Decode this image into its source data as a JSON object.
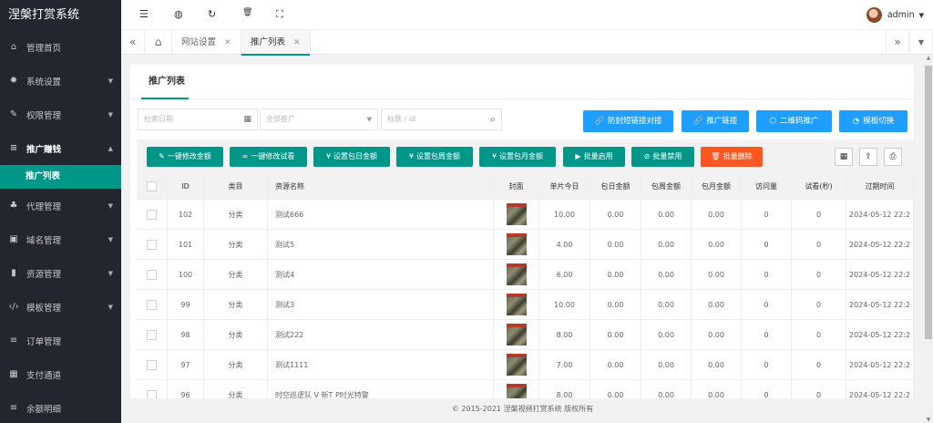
{
  "sidebar": {
    "logo": "涅槃打赏系统",
    "items": [
      {
        "label": "管理首页",
        "icon": "home-icon",
        "glyph": "⌂",
        "arrow": false
      },
      {
        "label": "系统设置",
        "icon": "gear-icon",
        "glyph": "✹",
        "arrow": true
      },
      {
        "label": "权限管理",
        "icon": "key-icon",
        "glyph": "✎",
        "arrow": true
      },
      {
        "label": "推广赚钱",
        "icon": "list-icon",
        "glyph": "≡",
        "arrow": true,
        "open": true
      },
      {
        "label": "代理管理",
        "icon": "users-icon",
        "glyph": "♣",
        "arrow": true
      },
      {
        "label": "域名管理",
        "icon": "domain-icon",
        "glyph": "▣",
        "arrow": true
      },
      {
        "label": "资源管理",
        "icon": "resource-icon",
        "glyph": "▮",
        "arrow": true
      },
      {
        "label": "模板管理",
        "icon": "code-icon",
        "glyph": "‹/›",
        "arrow": true
      },
      {
        "label": "订单管理",
        "icon": "order-icon",
        "glyph": "≡",
        "arrow": false
      },
      {
        "label": "支付通道",
        "icon": "payment-icon",
        "glyph": "▦",
        "arrow": false
      },
      {
        "label": "余额明细",
        "icon": "balance-icon",
        "glyph": "≡",
        "arrow": false
      }
    ],
    "sub_item": "推广列表"
  },
  "header": {
    "user": "admin"
  },
  "tabs": [
    "网站设置",
    "推广列表"
  ],
  "page": {
    "title": "推广列表",
    "search_date_placeholder": "检索日期",
    "search_promo_placeholder": "全部推广",
    "search_keyword_placeholder": "标题 / id",
    "actions": [
      {
        "label": "防封短链接对接",
        "icon": "link-icon",
        "glyph": "🔗"
      },
      {
        "label": "推广链接",
        "icon": "link-icon",
        "glyph": "🔗"
      },
      {
        "label": "二维码推广",
        "icon": "cube-icon",
        "glyph": "⬡"
      },
      {
        "label": "模板切换",
        "icon": "dashboard-icon",
        "glyph": "◔"
      }
    ],
    "toolbar": [
      {
        "label": "一键修改金额",
        "icon": "pencil-icon",
        "glyph": "✎"
      },
      {
        "label": "一键修改试看",
        "icon": "infinity-icon",
        "glyph": "∞"
      },
      {
        "label": "设置包日金额",
        "icon": "yen-icon",
        "glyph": "¥"
      },
      {
        "label": "设置包周金额",
        "icon": "yen-icon",
        "glyph": "¥"
      },
      {
        "label": "设置包月金额",
        "icon": "yen-icon",
        "glyph": "¥"
      },
      {
        "label": "批量启用",
        "icon": "play-icon",
        "glyph": "▶"
      },
      {
        "label": "批量禁用",
        "icon": "ban-icon",
        "glyph": "⊘"
      },
      {
        "label": "批量删除",
        "icon": "trash-icon",
        "glyph": "🗑"
      }
    ]
  },
  "table": {
    "columns": [
      "ID",
      "类目",
      "资源名称",
      "封面",
      "单片今日",
      "包日金额",
      "包周金额",
      "包月金额",
      "访问量",
      "试看(秒)",
      "过期时间"
    ],
    "rows": [
      {
        "id": "102",
        "category": "分类",
        "name": "测试666",
        "single": "10.00",
        "day": "0.00",
        "week": "0.00",
        "month": "0.00",
        "visits": "0",
        "trial": "0",
        "expire": "2024-05-12 22:2"
      },
      {
        "id": "101",
        "category": "分类",
        "name": "测试5",
        "single": "4.00",
        "day": "0.00",
        "week": "0.00",
        "month": "0.00",
        "visits": "0",
        "trial": "0",
        "expire": "2024-05-12 22:2"
      },
      {
        "id": "100",
        "category": "分类",
        "name": "测试4",
        "single": "6.00",
        "day": "0.00",
        "week": "0.00",
        "month": "0.00",
        "visits": "0",
        "trial": "0",
        "expire": "2024-05-12 22:2"
      },
      {
        "id": "99",
        "category": "分类",
        "name": "测试3",
        "single": "10.00",
        "day": "0.00",
        "week": "0.00",
        "month": "0.00",
        "visits": "0",
        "trial": "0",
        "expire": "2024-05-12 22:2"
      },
      {
        "id": "98",
        "category": "分类",
        "name": "测试222",
        "single": "8.00",
        "day": "0.00",
        "week": "0.00",
        "month": "0.00",
        "visits": "0",
        "trial": "0",
        "expire": "2024-05-12 22:2"
      },
      {
        "id": "97",
        "category": "分类",
        "name": "测试1111",
        "single": "7.00",
        "day": "0.00",
        "week": "0.00",
        "month": "0.00",
        "visits": "0",
        "trial": "0",
        "expire": "2024-05-12 22:2"
      },
      {
        "id": "96",
        "category": "分类",
        "name": "时空巡逻队 V 新T P时光特警",
        "single": "8.00",
        "day": "0.00",
        "week": "0.00",
        "month": "0.00",
        "visits": "0",
        "trial": "0",
        "expire": "2024-05-12 22:2"
      }
    ]
  },
  "footer": "© 2015-2021 涅槃视频打赏系统 版权所有"
}
